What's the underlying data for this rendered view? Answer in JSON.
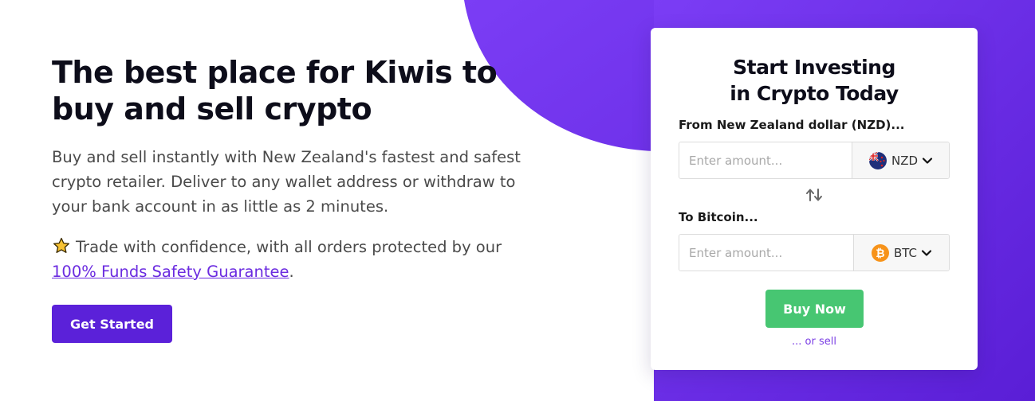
{
  "hero": {
    "title_line1": "The best place for Kiwis to",
    "title_line2": "buy and sell crypto",
    "description": "Buy and sell instantly with New Zealand's fastest and safest crypto retailer. Deliver to any wallet address or withdraw to your bank account in as little as 2 minutes.",
    "trust_text": "Trade with confidence, with all orders protected by our",
    "trust_link": "100% Funds Safety Guarantee",
    "trust_suffix": ".",
    "cta_label": "Get Started"
  },
  "widget": {
    "title_line1": "Start Investing",
    "title_line2": "in Crypto Today",
    "from_label": "From New Zealand dollar (NZD)...",
    "from_placeholder": "Enter amount...",
    "from_currency": "NZD",
    "to_label": "To Bitcoin...",
    "to_placeholder": "Enter amount...",
    "to_currency": "BTC",
    "buy_label": "Buy Now",
    "sell_link": "... or sell"
  },
  "icons": {
    "star": "star-icon",
    "nzd_flag": "nz-flag-icon",
    "btc": "bitcoin-icon",
    "chevron": "chevron-down-icon",
    "swap": "swap-arrows-icon"
  },
  "colors": {
    "brand_purple": "#5b21d9",
    "accent_green": "#47c672",
    "link_purple": "#6b2be0"
  }
}
